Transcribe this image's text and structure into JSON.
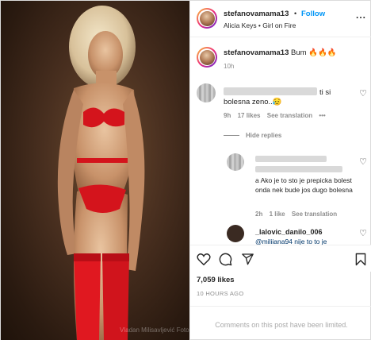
{
  "photo": {
    "watermark": "Vladan Milisavljević Fotografija"
  },
  "header": {
    "username": "stefanovamama13",
    "separator": "•",
    "follow_label": "Follow",
    "music": "Alicia Keys • Girl on Fire",
    "more_label": "..."
  },
  "caption": {
    "username": "stefanovamama13",
    "text": "Bum 🔥🔥🔥",
    "time": "10h"
  },
  "comments": [
    {
      "text_tail": "ti si",
      "text_line2": "bolesna zeno..😥",
      "time": "9h",
      "likes": "17 likes",
      "see_translation": "See translation",
      "more": "•••"
    }
  ],
  "replies_toggle": "Hide replies",
  "replies": [
    {
      "text": "a Ako je to sto je prepicka bolest onda nek bude jos dugo bolesna",
      "time": "2h",
      "likes": "1 like",
      "see_translation": "See translation"
    },
    {
      "username": "_lalovic_danilo_006",
      "text": "@miliiana94 nije to to je"
    }
  ],
  "post": {
    "likes": "7,059 likes",
    "time_ago": "10 HOURS AGO",
    "comments_limited": "Comments on this post have been limited."
  }
}
